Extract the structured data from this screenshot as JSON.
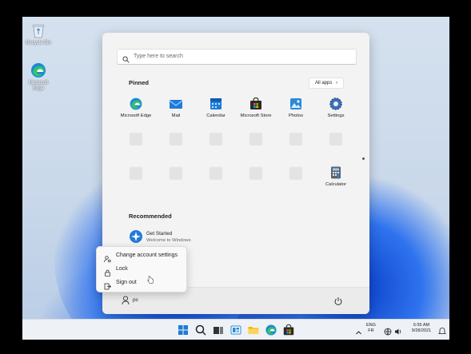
{
  "desktop": {
    "icons": [
      {
        "label": "Recycle Bin",
        "icon": "recycle-bin-icon"
      },
      {
        "label": "Microsoft Edge",
        "icon": "edge-icon"
      }
    ]
  },
  "start_menu": {
    "search": {
      "placeholder": "Type here to search"
    },
    "pinned_title": "Pinned",
    "all_apps_label": "All apps",
    "pinned_apps": [
      {
        "label": "Microsoft Edge",
        "icon": "edge-icon"
      },
      {
        "label": "Mail",
        "icon": "mail-icon"
      },
      {
        "label": "Calendar",
        "icon": "calendar-icon"
      },
      {
        "label": "Microsoft Store",
        "icon": "store-icon"
      },
      {
        "label": "Photos",
        "icon": "photos-icon"
      },
      {
        "label": "Settings",
        "icon": "settings-icon"
      },
      {
        "label": "Calculator",
        "icon": "calculator-icon"
      }
    ],
    "recommended_title": "Recommended",
    "recommended": [
      {
        "title": "Get Started",
        "subtitle": "Welcome to Windows",
        "icon": "get-started-icon"
      }
    ],
    "user_name": "pc"
  },
  "context_menu": {
    "items": [
      {
        "label": "Change account settings",
        "icon": "account-settings-icon"
      },
      {
        "label": "Lock",
        "icon": "lock-icon"
      },
      {
        "label": "Sign out",
        "icon": "sign-out-icon"
      }
    ]
  },
  "taskbar": {
    "apps": [
      "start-icon",
      "search-icon",
      "task-view-icon",
      "widgets-icon",
      "file-explorer-icon",
      "edge-icon",
      "store-icon"
    ],
    "language_line1": "ENG",
    "language_line2": "FR",
    "time": "6:55 AM",
    "date": "9/28/2021"
  },
  "colors": {
    "accent": "#0067c0",
    "wallpaper_blue": "#1e4fd8"
  }
}
